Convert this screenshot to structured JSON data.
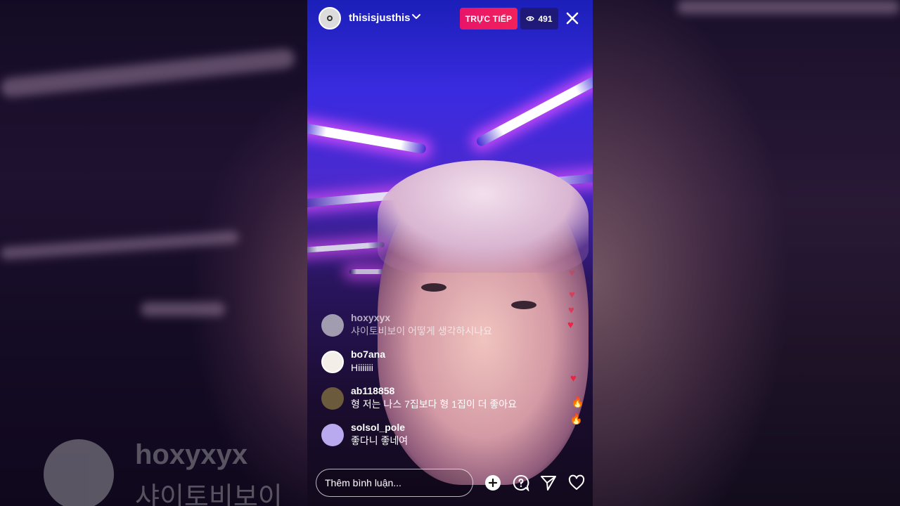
{
  "header": {
    "username": "thisisjusthis",
    "live_label": "TRỰC TIẾP",
    "viewer_count": "491"
  },
  "comments": [
    {
      "username": "hoxyxyx",
      "message": "샤이토비보이 어떻게 생각하시나요",
      "avatar_color": "#e6e6e6"
    },
    {
      "username": "bo7ana",
      "message": "Hiiiiiii",
      "avatar_color": "#f3efe8"
    },
    {
      "username": "ab118858",
      "message": "형 저는 나스 7집보다 형 1집이 더 좋아요",
      "avatar_color": "#6b5a3c"
    },
    {
      "username": "solsol_pole",
      "message": "좋다니 좋네여",
      "avatar_color": "#b9aaf0"
    }
  ],
  "background_echo": {
    "username": "hoxyxyx",
    "message_fragment": "샤이토비보이"
  },
  "bottom_bar": {
    "comment_placeholder": "Thêm bình luận..."
  },
  "icons": {
    "chevron": "chevron-down-icon",
    "eye": "eye-icon",
    "close": "close-icon",
    "add": "add-circle-icon",
    "question": "question-bubble-icon",
    "send": "send-icon",
    "like": "heart-outline-icon"
  },
  "colors": {
    "live_badge": "#ec1667",
    "reaction_heart": "#ee2244",
    "reaction_fire": "#ff7a1a"
  }
}
